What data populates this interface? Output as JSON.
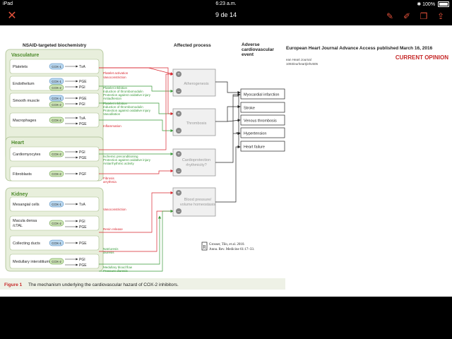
{
  "status_bar": {
    "device": "iPad",
    "time": "6:23 a.m.",
    "battery": "100%"
  },
  "toolbar": {
    "page_count": "9 de 14",
    "icons": [
      "close-icon",
      "pen-icon",
      "markup-icon",
      "window-icon",
      "share-icon"
    ]
  },
  "figure": {
    "headers": {
      "col1": "NSAID-targeted biochemistry",
      "col2": "Affected process",
      "col3_line1": "Adverse",
      "col3_line2": "cardiovascular",
      "col3_line3": "event"
    },
    "groups": {
      "vasculature": "Vasculature",
      "heart": "Heart",
      "kidney": "Kidney"
    },
    "cells": [
      {
        "name": "Platelets",
        "enzymes": [
          "COX-1"
        ],
        "products": [
          "TxA"
        ]
      },
      {
        "name": "Endothelium",
        "enzymes": [
          "COX-1",
          "COX-2"
        ],
        "products": [
          "PGE",
          "PGI"
        ]
      },
      {
        "name": "Smooth muscle",
        "enzymes": [
          "COX-1",
          "COX-2"
        ],
        "products": [
          "PGE",
          "PGI"
        ]
      },
      {
        "name": "Macrophages",
        "enzymes": [
          "COX-2"
        ],
        "products": [
          "TxA",
          "PGE"
        ]
      },
      {
        "name": "Cardiomyocytes",
        "enzymes": [
          "COX-2"
        ],
        "products": [
          "PGI",
          "PGE"
        ]
      },
      {
        "name": "Fibroblasts",
        "enzymes": [
          "COX-2"
        ],
        "products": [
          "PGF"
        ]
      },
      {
        "name": "Mesangial cells",
        "enzymes": [
          "COX-1"
        ],
        "products": [
          "TxA"
        ]
      },
      {
        "name": "Macula densa /cTAL",
        "enzymes": [
          "COX-2"
        ],
        "products": [
          "PGI",
          "PGE"
        ]
      },
      {
        "name": "Collecting ducts",
        "enzymes": [
          "COX-1"
        ],
        "products": [
          "PGE"
        ]
      },
      {
        "name": "Medullary interstitium",
        "enzymes": [
          "COX-2"
        ],
        "products": [
          "PGI",
          "PGE"
        ]
      }
    ],
    "effects": [
      "Platelet activation",
      "Vasoconstriction",
      "Platelet inhibition",
      "Induction of thrombomodulin",
      "Protection against oxidative injury",
      "Antiadhesion",
      "Platelet inhibition",
      "Induction of thrombomodulin",
      "Protection against oxidative injury",
      "Vasodilation",
      "Inflammation",
      "Ischemic preconditioning",
      "Protection against oxidative injury",
      "Antiarrhythmic activity",
      "Fibrosis",
      "arrythmia",
      "Vasoconstriction",
      "Renin release",
      "Natriuresis",
      "diuresis",
      "Medullary blood flow",
      "Pressure diuresis"
    ],
    "processes": [
      "Atherogenesis",
      "Thrombosis",
      "Cardioprotection",
      "rhythmicity?",
      "Blood pressure/",
      "volume homeostasis"
    ],
    "events": [
      "Myocardial infarction",
      "Stroke",
      "Venous thrombosis",
      "Hypertension",
      "Heart failure"
    ],
    "caption_label": "Figure 1",
    "caption_text": "The mechanism underlying the cardiovascular hazard of COX-2 inhibitors."
  },
  "journal": {
    "header": "European Heart Journal Advance Access published March 16, 2016",
    "section": "CURRENT OPINION",
    "small_line1": "ean Heart Journal",
    "small_line2": "1093/eurheartj/ehv505"
  },
  "citation": {
    "line1": "Grosser, Tilo, et al. 2010.",
    "line2": "Annu. Rev. Medicine 61:17–33."
  },
  "colors": {
    "accent": "#e0503a",
    "box_fill": "#e8efdc",
    "box_stroke": "#a9bf8e",
    "group_title": "#4c8a2a",
    "red_line": "#d9262f",
    "green_line": "#3a9a3a",
    "cox1": "#b9d7ef",
    "cox2": "#cfe6b8"
  }
}
